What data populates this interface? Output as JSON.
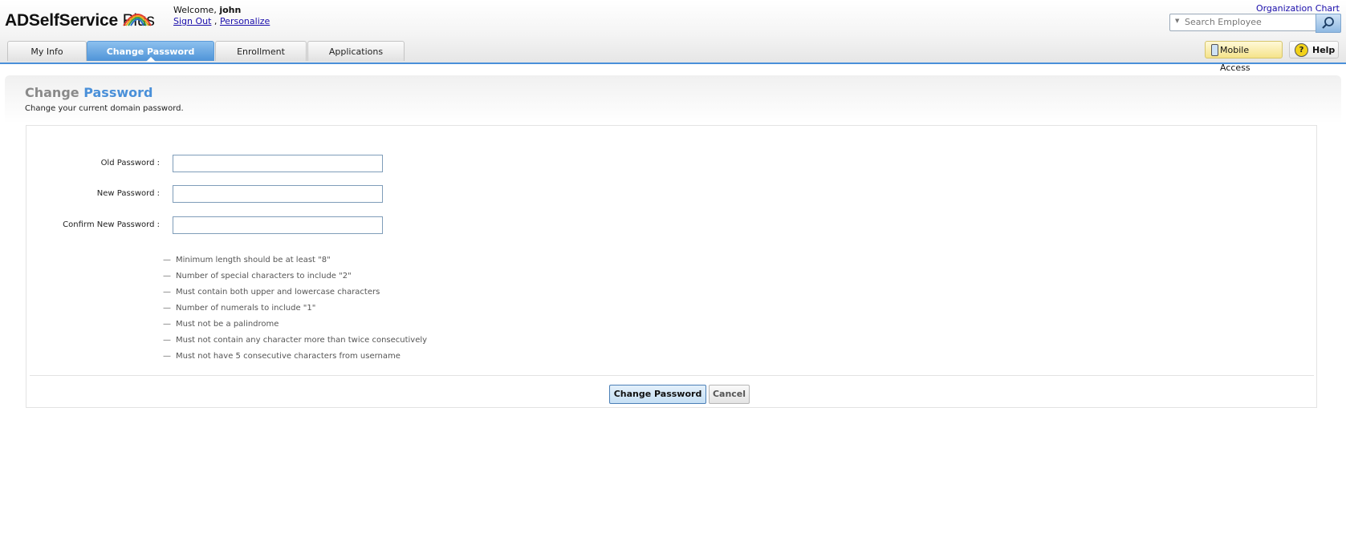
{
  "brand": {
    "name_bold": "ADSelfService",
    "name_plain": " Plus"
  },
  "header": {
    "welcome_prefix": "Welcome, ",
    "username": "john",
    "sign_out": "Sign Out",
    "separator": " , ",
    "personalize": "Personalize",
    "org_chart": "Organization Chart",
    "search_placeholder": "Search Employee"
  },
  "tabs": [
    {
      "label": "My Info",
      "active": false
    },
    {
      "label": "Change Password",
      "active": true
    },
    {
      "label": "Enrollment",
      "active": false
    },
    {
      "label": "Applications",
      "active": false
    }
  ],
  "toolbar": {
    "mobile_access": "Mobile Access",
    "help": "Help"
  },
  "page": {
    "title_part1": "Change ",
    "title_part2": "Password",
    "subtitle": "Change your current domain password."
  },
  "form": {
    "old_password_label": "Old Password :",
    "new_password_label": "New Password :",
    "confirm_password_label": "Confirm New Password :",
    "old_password_value": "",
    "new_password_value": "",
    "confirm_password_value": ""
  },
  "policy_rules": [
    "Minimum length should be at least \"8\"",
    "Number of special characters to include \"2\"",
    "Must contain both upper and lowercase characters",
    "Number of numerals to include \"1\"",
    "Must not be a palindrome",
    "Must not contain any character more than twice consecutively",
    "Must not have 5 consecutive characters from username"
  ],
  "actions": {
    "submit": "Change Password",
    "cancel": "Cancel"
  },
  "colors": {
    "accent": "#4a90d9",
    "title_gray": "#8a8a8a",
    "link": "#1a0dab"
  }
}
